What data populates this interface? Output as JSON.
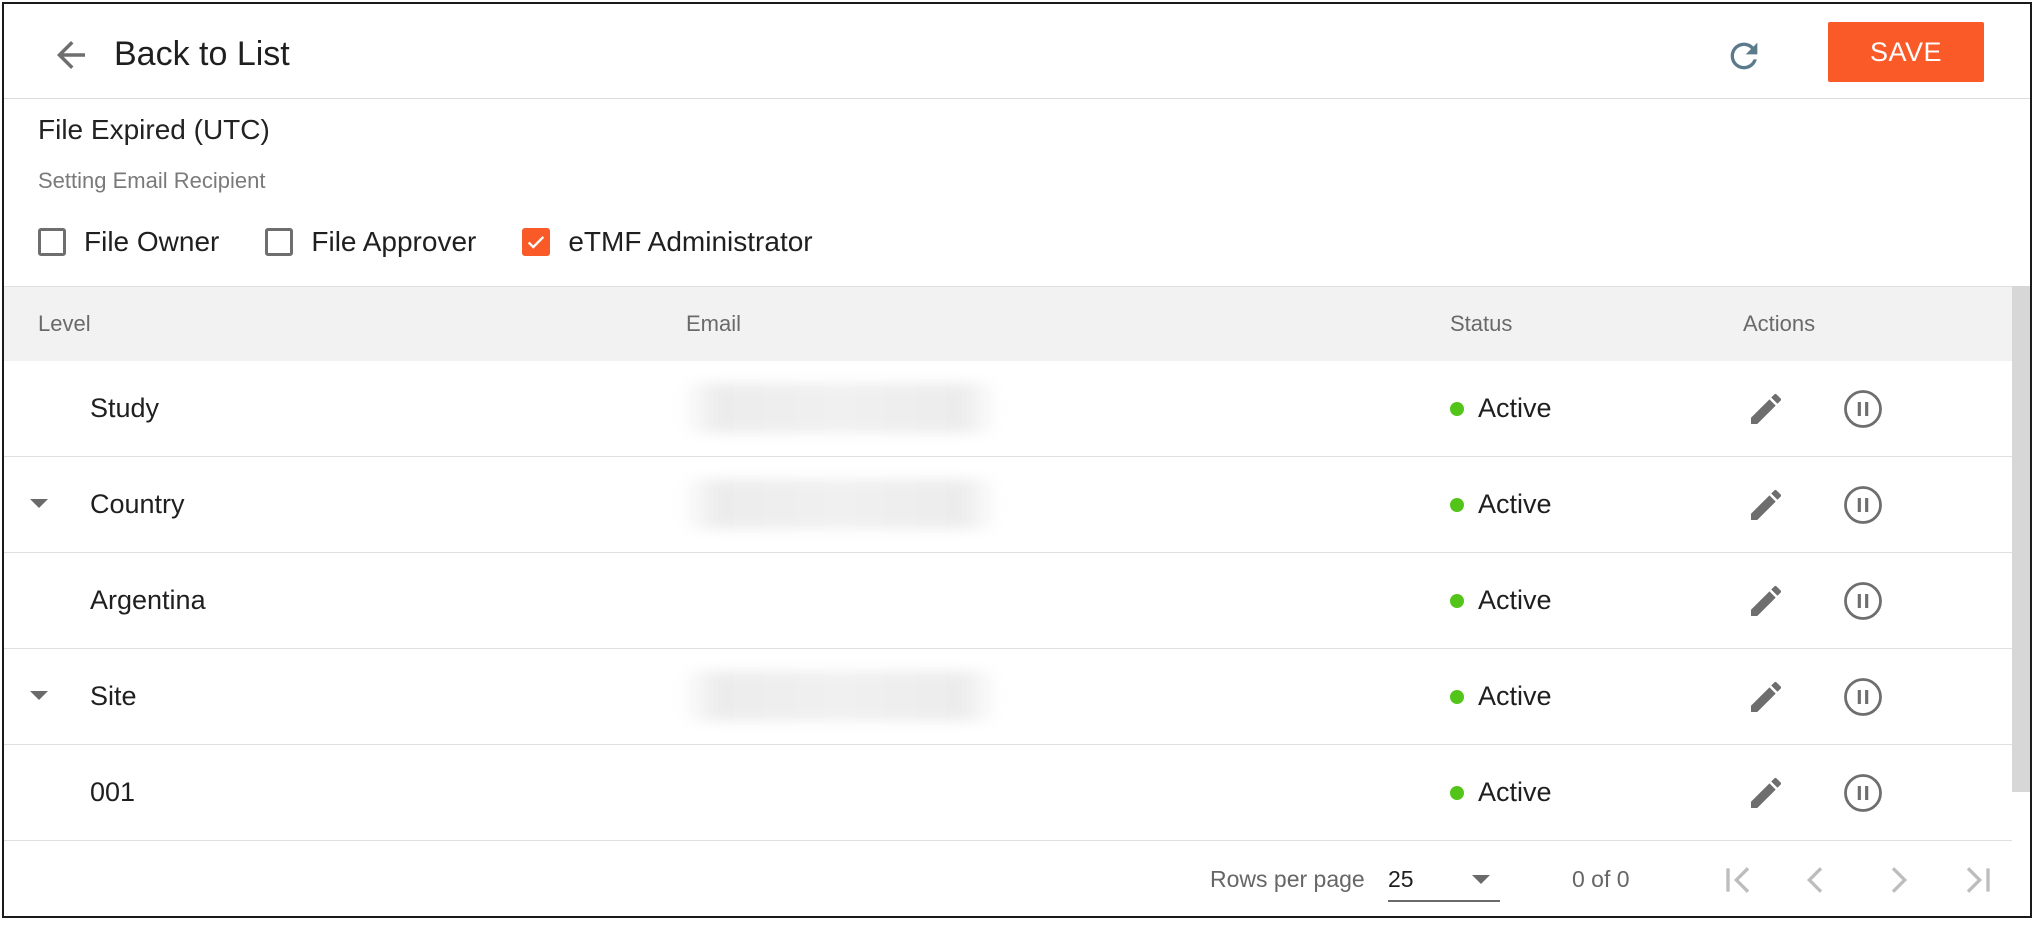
{
  "header": {
    "back_label": "Back to List",
    "save_label": "SAVE"
  },
  "section": {
    "title": "File Expired (UTC)",
    "subtitle": "Setting Email Recipient",
    "checkboxes": [
      {
        "label": "File Owner",
        "checked": false
      },
      {
        "label": "File Approver",
        "checked": false
      },
      {
        "label": "eTMF Administrator",
        "checked": true
      }
    ]
  },
  "table": {
    "columns": [
      "Level",
      "Email",
      "Status",
      "Actions"
    ],
    "rows": [
      {
        "level": "Study",
        "email_blurred": true,
        "status": "Active",
        "expandable": false
      },
      {
        "level": "Country",
        "email_blurred": true,
        "status": "Active",
        "expandable": true
      },
      {
        "level": "Argentina",
        "email_blurred": false,
        "status": "Active",
        "expandable": false
      },
      {
        "level": "Site",
        "email_blurred": true,
        "status": "Active",
        "expandable": true
      },
      {
        "level": "001",
        "email_blurred": false,
        "status": "Active",
        "expandable": false
      }
    ]
  },
  "pagination": {
    "rows_per_page_label": "Rows per page",
    "rows_per_page": "25",
    "page_info": "0 of 0"
  },
  "colors": {
    "accent": "#fa5a28",
    "status_active": "#52c41a",
    "icon_gray": "#6e6e6e"
  },
  "icons": [
    "arrow-left-icon",
    "refresh-icon",
    "checkmark-icon",
    "caret-down-icon",
    "pencil-icon",
    "pause-circle-icon",
    "first-page-icon",
    "prev-page-icon",
    "next-page-icon",
    "last-page-icon"
  ]
}
